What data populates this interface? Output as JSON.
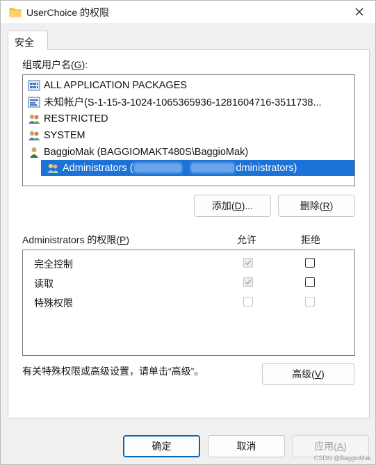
{
  "window": {
    "title": "UserChoice 的权限",
    "folder_icon": "folder-icon",
    "close_icon": "close-icon"
  },
  "tabs": [
    {
      "label": "安全",
      "selected": true
    }
  ],
  "groups": {
    "label_prefix": "组或用户名(",
    "label_key": "G",
    "label_suffix": "):",
    "items": [
      {
        "icon": "app-packages-icon",
        "label": "ALL APPLICATION PACKAGES"
      },
      {
        "icon": "unknown-account-icon",
        "label": "未知帐户(S-1-15-3-1024-1065365936-1281604716-3511738..."
      },
      {
        "icon": "user-group-icon",
        "label": "RESTRICTED"
      },
      {
        "icon": "user-group-icon",
        "label": "SYSTEM"
      },
      {
        "icon": "user-icon",
        "label": "BaggioMak (BAGGIOMAKT480S\\BaggioMak)"
      },
      {
        "icon": "user-group-icon",
        "label_start": "Administrators (",
        "label_end": "dministrators)",
        "selected": true
      }
    ]
  },
  "buttons": {
    "add_label": "添加(",
    "add_key": "D",
    "add_suffix": ")...",
    "remove_label": "删除(",
    "remove_key": "R",
    "remove_suffix": ")",
    "advanced_label": "高级(",
    "advanced_key": "V",
    "advanced_suffix": ")"
  },
  "permissions": {
    "label_prefix": "Administrators 的权限(",
    "label_key": "P",
    "label_suffix": ")",
    "allow_header": "允许",
    "deny_header": "拒绝",
    "rows": [
      {
        "name": "完全控制",
        "allow": "checked-disabled",
        "deny": "unchecked"
      },
      {
        "name": "读取",
        "allow": "checked-disabled",
        "deny": "unchecked"
      },
      {
        "name": "特殊权限",
        "allow": "disabled",
        "deny": "disabled"
      }
    ]
  },
  "advanced_hint": "有关特殊权限或高级设置，请单击“高级”。",
  "footer": {
    "ok": "确定",
    "cancel": "取消",
    "apply_label": "应用(",
    "apply_key": "A",
    "apply_suffix": ")"
  },
  "watermark": "CSDN @BaggioMak",
  "colors": {
    "selection": "#1c72d6",
    "primary_border": "#0067c0",
    "folder": "#f5c242"
  }
}
